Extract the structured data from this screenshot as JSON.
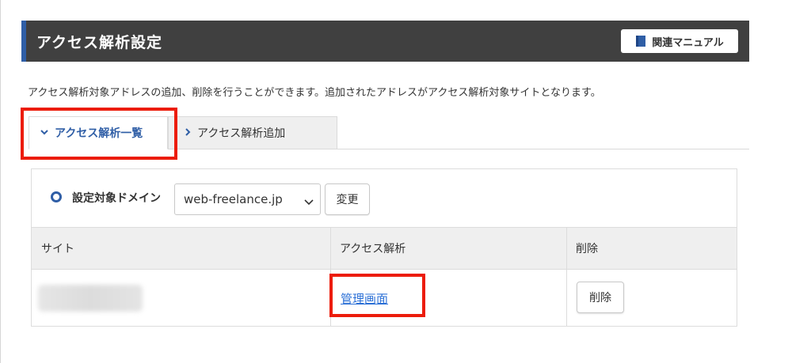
{
  "header": {
    "title": "アクセス解析設定",
    "manual_button_label": "関連マニュアル",
    "background_color": "#404040",
    "accent_color": "#2f5ea6"
  },
  "description": "アクセス解析対象アドレスの追加、削除を行うことができます。追加されたアドレスがアクセス解析対象サイトとなります。",
  "tabs": [
    {
      "label": "アクセス解析一覧",
      "icon": "chevron-down-icon",
      "active": true
    },
    {
      "label": "アクセス解析追加",
      "icon": "chevron-right-icon",
      "active": false
    }
  ],
  "domain_selector": {
    "label": "設定対象ドメイン",
    "icon": "ring-icon",
    "selected_value": "web-freelance.jp",
    "change_button_label": "変更"
  },
  "table": {
    "columns": [
      "サイト",
      "アクセス解析",
      "削除"
    ],
    "rows": [
      {
        "site": "",
        "analysis_link_label": "管理画面",
        "delete_button_label": "削除"
      }
    ]
  },
  "highlight_color": "#ec1c0b",
  "link_color": "#2a6fd6"
}
